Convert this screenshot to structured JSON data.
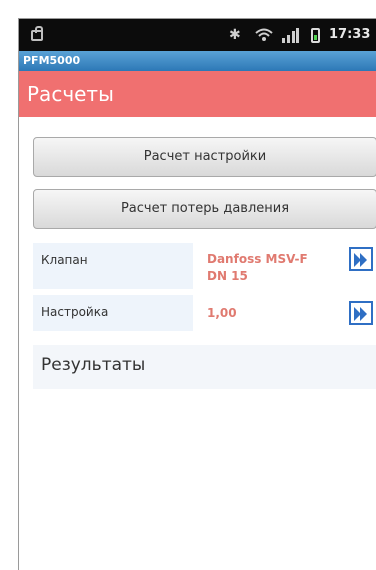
{
  "status_bar": {
    "time": "17:33"
  },
  "app": {
    "name": "PFM5000"
  },
  "screen": {
    "title": "Расчеты"
  },
  "buttons": {
    "settings_calc": "Расчет настройки",
    "pressure_loss_calc": "Расчет потерь давления"
  },
  "fields": [
    {
      "label": "Клапан",
      "value_line1": "Danfoss MSV-F",
      "value_line2": "DN 15"
    },
    {
      "label": "Настройка",
      "value": "1,00"
    }
  ],
  "results": {
    "label": "Результаты"
  },
  "colors": {
    "header": "#f07070",
    "titlebar": "#3f8cc6",
    "value_text": "#e07a70",
    "arrow_border": "#2f6fc4"
  }
}
